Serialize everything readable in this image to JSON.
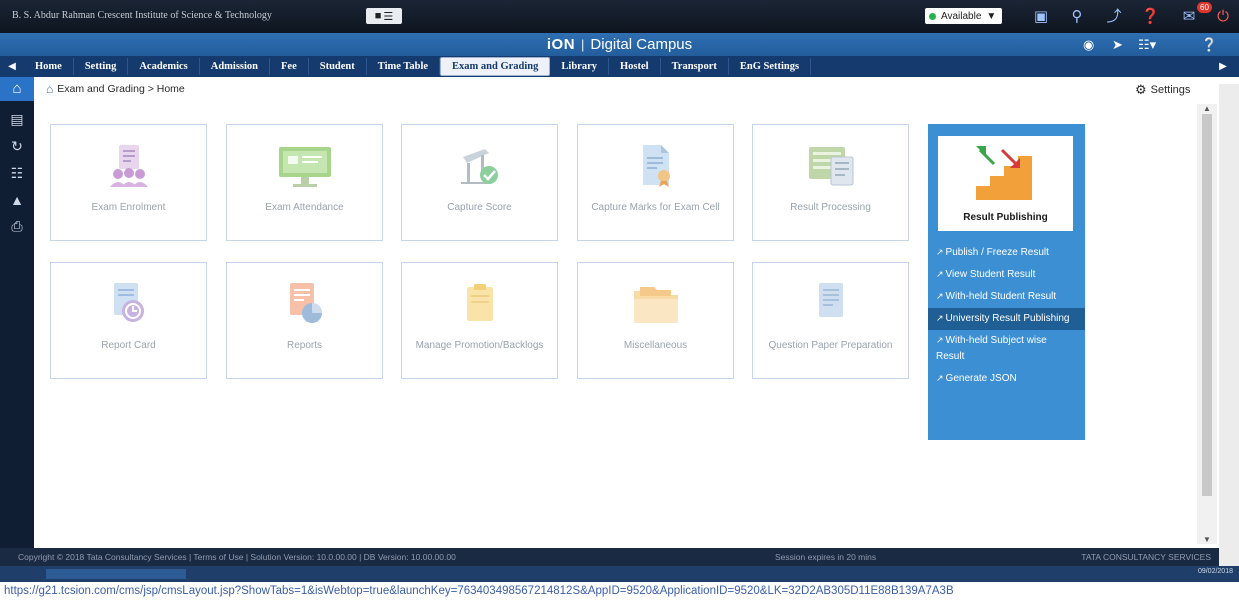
{
  "topbar": {
    "institution": "B. S. Abdur Rahman Crescent Institute of Science & Technology",
    "status": "Available",
    "notification_count": "60"
  },
  "brand": {
    "logo": "iON",
    "product": "Digital Campus"
  },
  "menu": {
    "items": [
      {
        "label": "Home"
      },
      {
        "label": "Setting"
      },
      {
        "label": "Academics"
      },
      {
        "label": "Admission"
      },
      {
        "label": "Fee"
      },
      {
        "label": "Student"
      },
      {
        "label": "Time Table"
      },
      {
        "label": "Exam and Grading"
      },
      {
        "label": "Library"
      },
      {
        "label": "Hostel"
      },
      {
        "label": "Transport"
      },
      {
        "label": "EnG Settings"
      }
    ],
    "active": "Exam and Grading"
  },
  "breadcrumb": {
    "path": "Exam and Grading > Home"
  },
  "settings_label": "Settings",
  "tiles": [
    {
      "label": "Exam Enrolment",
      "icon": "exam-enrolment-icon"
    },
    {
      "label": "Exam Attendance",
      "icon": "exam-attendance-icon"
    },
    {
      "label": "Capture Score",
      "icon": "capture-score-icon"
    },
    {
      "label": "Capture Marks for Exam Cell",
      "icon": "capture-marks-icon"
    },
    {
      "label": "Result Processing",
      "icon": "result-processing-icon"
    },
    {
      "label": "Report Card",
      "icon": "report-card-icon"
    },
    {
      "label": "Reports",
      "icon": "reports-icon"
    },
    {
      "label": "Manage Promotion/Backlogs",
      "icon": "manage-promotion-icon"
    },
    {
      "label": "Miscellaneous",
      "icon": "miscellaneous-icon"
    },
    {
      "label": "Question Paper Preparation",
      "icon": "question-paper-icon"
    }
  ],
  "result_publishing": {
    "title": "Result Publishing",
    "links": [
      {
        "label": "Publish / Freeze Result"
      },
      {
        "label": "View Student Result"
      },
      {
        "label": "With-held Student Result"
      },
      {
        "label": "University Result Publishing"
      },
      {
        "label": "With-held Subject wise Result"
      },
      {
        "label": "Generate JSON"
      }
    ],
    "highlighted": "University Result Publishing"
  },
  "footer": {
    "left": "Copyright © 2018 Tata Consultancy Services | Terms of Use | Solution Version: 10.0.00.00 | DB Version: 10.00.00.00",
    "middle": "Session expires in 20 mins",
    "right": "TATA CONSULTANCY SERVICES"
  },
  "taskbar": {
    "clock": "09/02/2018"
  },
  "url": "https://g21.tcsion.com/cms/jsp/cmsLayout.jsp?ShowTabs=1&isWebtop=true&launchKey=763403498567214812S&AppID=9520&ApplicationID=9520&LK=32D2AB305D11E88B139A7A3B"
}
